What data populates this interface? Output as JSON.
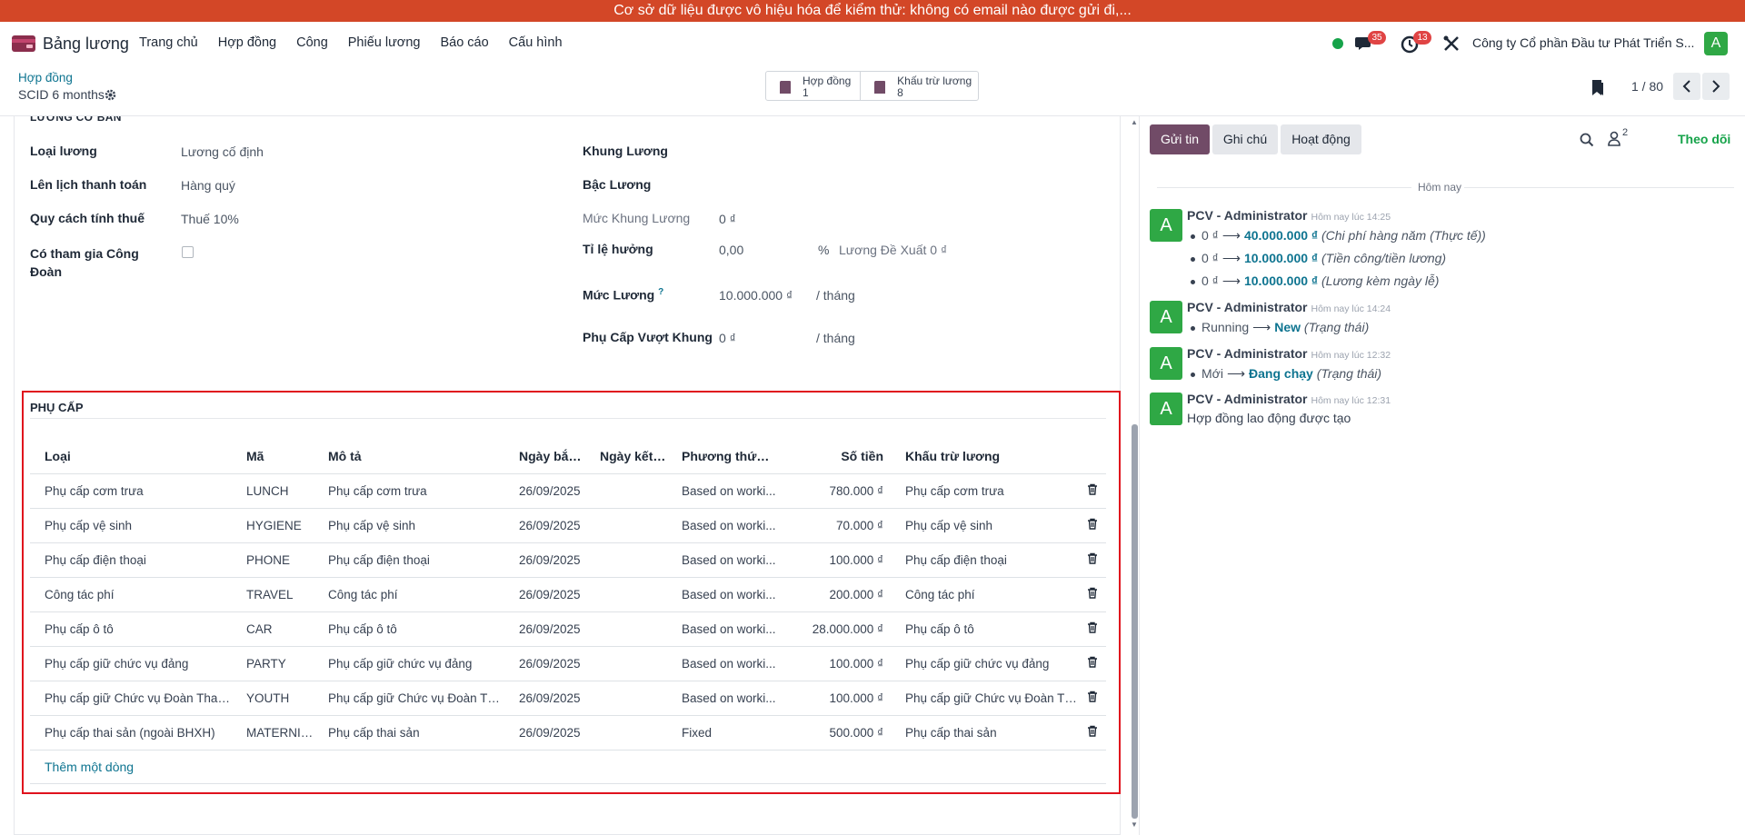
{
  "banner": "Cơ sở dữ liệu được vô hiệu hóa để kiểm thử: không có email nào được gửi đi,...",
  "app": {
    "name": "Bảng lương",
    "menu": [
      "Trang chủ",
      "Hợp đồng",
      "Công",
      "Phiếu lương",
      "Báo cáo",
      "Cấu hình"
    ],
    "chat_badge": "35",
    "activity_badge": "13",
    "company": "Công ty Cổ phần Đầu tư Phát Triển S...",
    "user_initial": "A"
  },
  "control": {
    "breadcrumb": "Hợp đồng",
    "record": "SCID 6 months",
    "smart_buttons": [
      {
        "label": "Hợp đồng",
        "count": "1"
      },
      {
        "label": "Khấu trừ lương",
        "count": "8"
      }
    ],
    "pager": "1 / 80"
  },
  "salary": {
    "section_title": "LƯƠNG CƠ BẢN",
    "left": [
      {
        "label": "Loại lương",
        "value": "Lương cố định"
      },
      {
        "label": "Lên lịch thanh toán",
        "value": "Hàng quý"
      },
      {
        "label": "Quy cách tính thuế",
        "value": "Thuế 10%"
      },
      {
        "label": "Có tham gia Công Đoàn",
        "value": ""
      }
    ],
    "right": {
      "khung_luong": "Khung Lương",
      "bac_luong": "Bậc Lương",
      "muc_khung_label": "Mức Khung Lương",
      "muc_khung_value": "0 ₫",
      "ti_le_label": "Tỉ lệ hưởng",
      "ti_le_value": "0,00",
      "ti_le_unit": "%",
      "de_xuat": "Lương Đề Xuất 0 ₫",
      "muc_luong_label": "Mức Lương",
      "muc_luong_help": "?",
      "muc_luong_value": "10.000.000 ₫",
      "per_month": "/ tháng",
      "vuot_khung_label": "Phụ Cấp Vượt Khung",
      "vuot_khung_value": "0 ₫"
    }
  },
  "allowance": {
    "title": "PHỤ CẤP",
    "columns": [
      "Loại",
      "Mã",
      "Mô tả",
      "Ngày bắt ...",
      "Ngày kết t...",
      "Phương thức t...",
      "Số tiền",
      "Khấu trừ lương"
    ],
    "rows": [
      [
        "Phụ cấp cơm trưa",
        "LUNCH",
        "Phụ cấp cơm trưa",
        "26/09/2025",
        "",
        "Based on worki...",
        "780.000 ₫",
        "Phụ cấp cơm trưa"
      ],
      [
        "Phụ cấp vệ sinh",
        "HYGIENE",
        "Phụ cấp vệ sinh",
        "26/09/2025",
        "",
        "Based on worki...",
        "70.000 ₫",
        "Phụ cấp vệ sinh"
      ],
      [
        "Phụ cấp điện thoại",
        "PHONE",
        "Phụ cấp điện thoại",
        "26/09/2025",
        "",
        "Based on worki...",
        "100.000 ₫",
        "Phụ cấp điện thoại"
      ],
      [
        "Công tác phí",
        "TRAVEL",
        "Công tác phí",
        "26/09/2025",
        "",
        "Based on worki...",
        "200.000 ₫",
        "Công tác phí"
      ],
      [
        "Phụ cấp ô tô",
        "CAR",
        "Phụ cấp ô tô",
        "26/09/2025",
        "",
        "Based on worki...",
        "28.000.000 ₫",
        "Phụ cấp ô tô"
      ],
      [
        "Phụ cấp giữ chức vụ đảng",
        "PARTY",
        "Phụ cấp giữ chức vụ đảng",
        "26/09/2025",
        "",
        "Based on worki...",
        "100.000 ₫",
        "Phụ cấp giữ chức vụ đảng"
      ],
      [
        "Phụ cấp giữ Chức vụ Đoàn Than...",
        "YOUTH",
        "Phụ cấp giữ Chức vụ Đoàn Tha...",
        "26/09/2025",
        "",
        "Based on worki...",
        "100.000 ₫",
        "Phụ cấp giữ Chức vụ Đoàn Tha..."
      ],
      [
        "Phụ cấp thai sản (ngoài BHXH)",
        "MATERNITY",
        "Phụ cấp thai sản",
        "26/09/2025",
        "",
        "Fixed",
        "500.000 ₫",
        "Phụ cấp thai sản"
      ]
    ],
    "add_line": "Thêm một dòng"
  },
  "chatter": {
    "send": "Gửi tin",
    "note": "Ghi chú",
    "activity": "Hoạt động",
    "followers_count": "2",
    "follow": "Theo dõi",
    "today": "Hôm nay",
    "messages": [
      {
        "author": "PCV - Administrator",
        "date": "Hôm nay lúc 14:25",
        "tracks": [
          {
            "old": "0 ₫",
            "new": "40.000.000 ₫",
            "field": "(Chi phí hàng năm (Thực tế))"
          },
          {
            "old": "0 ₫",
            "new": "10.000.000 ₫",
            "field": "(Tiền công/tiền lương)"
          },
          {
            "old": "0 ₫",
            "new": "10.000.000 ₫",
            "field": "(Lương kèm ngày lễ)"
          }
        ]
      },
      {
        "author": "PCV - Administrator",
        "date": "Hôm nay lúc 14:24",
        "tracks": [
          {
            "old": "Running",
            "new": "New",
            "field": "(Trạng thái)"
          }
        ]
      },
      {
        "author": "PCV - Administrator",
        "date": "Hôm nay lúc 12:32",
        "tracks": [
          {
            "old": "Mới",
            "new": "Đang chạy",
            "field": "(Trạng thái)"
          }
        ]
      },
      {
        "author": "PCV - Administrator",
        "date": "Hôm nay lúc 12:31",
        "body": "Hợp đồng lao động được tạo"
      }
    ]
  },
  "colors": {
    "banner": "#d34727",
    "accent": "#714b67",
    "link": "#0e7490",
    "avatar": "#2fa845",
    "highlight_border": "#e0121d"
  },
  "icons": [
    "app-icon",
    "chat-icon",
    "clock-icon",
    "tools-icon",
    "gear-icon",
    "book-icon",
    "bookmark-icon",
    "chevron-left-icon",
    "chevron-right-icon",
    "trash-icon",
    "search-icon",
    "user-icon"
  ]
}
